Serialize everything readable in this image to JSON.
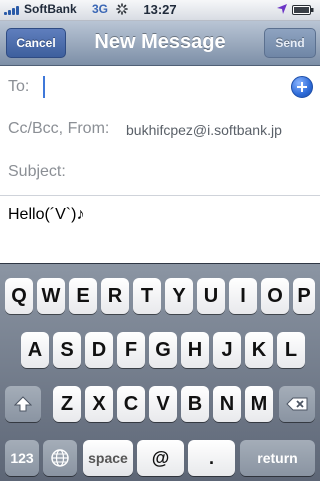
{
  "status_bar": {
    "carrier": "SoftBank",
    "network": "3G",
    "time": "13:27"
  },
  "nav": {
    "cancel_label": "Cancel",
    "title": "New Message",
    "send_label": "Send"
  },
  "fields": {
    "to_label": "To:",
    "ccbcc_label": "Cc/Bcc, From:",
    "from_email": "bukhifcpez@i.softbank.jp",
    "subject_label": "Subject:"
  },
  "message": {
    "body": "Hello(´V`)♪"
  },
  "keyboard": {
    "row1": [
      "Q",
      "W",
      "E",
      "R",
      "T",
      "Y",
      "U",
      "I",
      "O",
      "P"
    ],
    "row2": [
      "A",
      "S",
      "D",
      "F",
      "G",
      "H",
      "J",
      "K",
      "L"
    ],
    "row3": [
      "Z",
      "X",
      "C",
      "V",
      "B",
      "N",
      "M"
    ],
    "bottom": {
      "numbers": "123",
      "space": "space",
      "at": "@",
      "dot": ".",
      "return": "return"
    },
    "icons": {
      "shift": "shift-icon",
      "delete": "delete-icon",
      "globe": "globe-icon"
    }
  }
}
